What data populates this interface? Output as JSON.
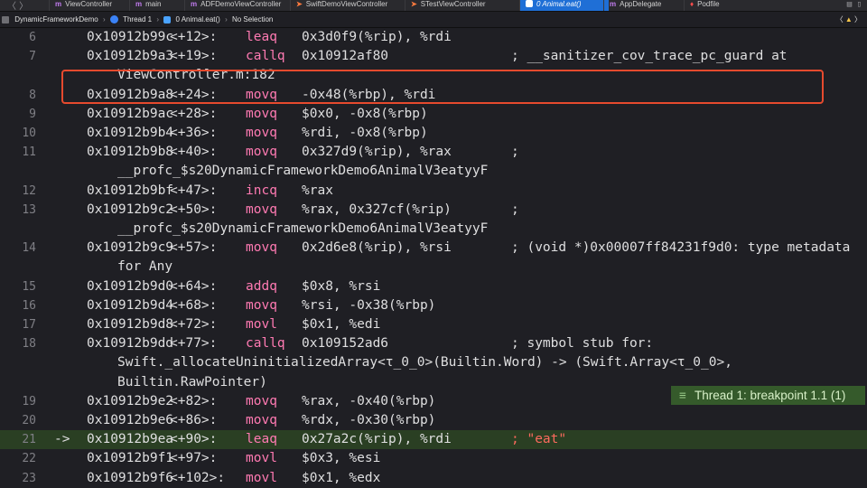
{
  "tabs": [
    {
      "label": "ViewController",
      "type": "m"
    },
    {
      "label": "main",
      "type": "m"
    },
    {
      "label": "ADFDemoViewController",
      "type": "m"
    },
    {
      "label": "SwiftDemoViewController",
      "type": "swift"
    },
    {
      "label": "STestViewController",
      "type": "swift"
    },
    {
      "label": "0 Animal.eat()",
      "type": "frame",
      "active": true
    },
    {
      "label": "AppDelegate",
      "type": "m"
    },
    {
      "label": "Podfile",
      "type": "pod"
    }
  ],
  "jumpbar": {
    "project": "DynamicFrameworkDemo",
    "thread": "Thread 1",
    "frame": "0 Animal.eat()",
    "selection": "No Selection"
  },
  "lines": [
    {
      "ln": "6",
      "addr": "0x10912b99c",
      "off": "<+12>:",
      "mn": "leaq",
      "op": "0x3d0f9(%rip), %rdi",
      "cmt": "",
      "cont": ""
    },
    {
      "ln": "7",
      "addr": "0x10912b9a3",
      "off": "<+19>:",
      "mn": "callq",
      "op": "0x10912af80",
      "cmt": "; __sanitizer_cov_trace_pc_guard at",
      "cont": "ViewController.m:182"
    },
    {
      "ln": "8",
      "addr": "0x10912b9a8",
      "off": "<+24>:",
      "mn": "movq",
      "op": "-0x48(%rbp), %rdi",
      "cmt": "",
      "cont": ""
    },
    {
      "ln": "9",
      "addr": "0x10912b9ac",
      "off": "<+28>:",
      "mn": "movq",
      "op": "$0x0, -0x8(%rbp)",
      "cmt": "",
      "cont": ""
    },
    {
      "ln": "10",
      "addr": "0x10912b9b4",
      "off": "<+36>:",
      "mn": "movq",
      "op": "%rdi, -0x8(%rbp)",
      "cmt": "",
      "cont": ""
    },
    {
      "ln": "11",
      "addr": "0x10912b9b8",
      "off": "<+40>:",
      "mn": "movq",
      "op": "0x327d9(%rip), %rax",
      "cmt": ";",
      "cont": "__profc_$s20DynamicFrameworkDemo6AnimalV3eatyyF"
    },
    {
      "ln": "12",
      "addr": "0x10912b9bf",
      "off": "<+47>:",
      "mn": "incq",
      "op": "%rax",
      "cmt": "",
      "cont": ""
    },
    {
      "ln": "13",
      "addr": "0x10912b9c2",
      "off": "<+50>:",
      "mn": "movq",
      "op": "%rax, 0x327cf(%rip)",
      "cmt": ";",
      "cont": "__profc_$s20DynamicFrameworkDemo6AnimalV3eatyyF"
    },
    {
      "ln": "14",
      "addr": "0x10912b9c9",
      "off": "<+57>:",
      "mn": "movq",
      "op": "0x2d6e8(%rip), %rsi",
      "cmt": "; (void *)0x00007ff84231f9d0: type metadata",
      "cont": "for Any"
    },
    {
      "ln": "15",
      "addr": "0x10912b9d0",
      "off": "<+64>:",
      "mn": "addq",
      "op": "$0x8, %rsi",
      "cmt": "",
      "cont": ""
    },
    {
      "ln": "16",
      "addr": "0x10912b9d4",
      "off": "<+68>:",
      "mn": "movq",
      "op": "%rsi, -0x38(%rbp)",
      "cmt": "",
      "cont": ""
    },
    {
      "ln": "17",
      "addr": "0x10912b9d8",
      "off": "<+72>:",
      "mn": "movl",
      "op": "$0x1, %edi",
      "cmt": "",
      "cont": ""
    },
    {
      "ln": "18",
      "addr": "0x10912b9dd",
      "off": "<+77>:",
      "mn": "callq",
      "op": "0x109152ad6",
      "cmt": "; symbol stub for:",
      "cont": "Swift._allocateUninitializedArray<τ_0_0>(Builtin.Word) -> (Swift.Array<τ_0_0>,",
      "cont2": "Builtin.RawPointer)"
    },
    {
      "ln": "19",
      "addr": "0x10912b9e2",
      "off": "<+82>:",
      "mn": "movq",
      "op": "%rax, -0x40(%rbp)",
      "cmt": "",
      "cont": ""
    },
    {
      "ln": "20",
      "addr": "0x10912b9e6",
      "off": "<+86>:",
      "mn": "movq",
      "op": "%rdx, -0x30(%rbp)",
      "cmt": "",
      "cont": ""
    },
    {
      "ln": "21",
      "addr": "0x10912b9ea",
      "off": "<+90>:",
      "mn": "leaq",
      "op": "0x27a2c(%rip), %rdi",
      "cmt": "; \"eat\"",
      "cont": "",
      "current": true
    },
    {
      "ln": "22",
      "addr": "0x10912b9f1",
      "off": "<+97>:",
      "mn": "movl",
      "op": "$0x3, %esi",
      "cmt": "",
      "cont": ""
    },
    {
      "ln": "23",
      "addr": "0x10912b9f6",
      "off": "<+102>:",
      "mn": "movl",
      "op": "$0x1, %edx",
      "cmt": "",
      "cont": ""
    }
  ],
  "pc_arrow": "->",
  "breakpoint_label": "Thread 1: breakpoint 1.1 (1)",
  "colors": {
    "keyword": "#ff7ab2",
    "number": "#d0bf69",
    "string": "#fc6a5d",
    "highlight_row": "#2a3f23",
    "annotation_box": "#e64a2e",
    "active_tab": "#1f6fd6"
  }
}
